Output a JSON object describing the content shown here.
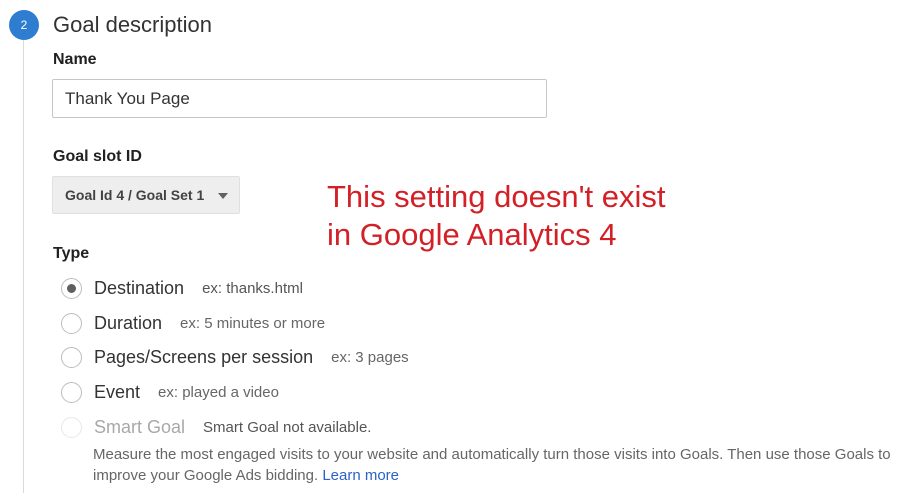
{
  "step": {
    "number": "2",
    "title": "Goal description"
  },
  "name_field": {
    "label": "Name",
    "value": "Thank You Page"
  },
  "goal_slot": {
    "label": "Goal slot ID",
    "selected": "Goal Id 4 / Goal Set 1"
  },
  "annotation": {
    "line1": "This setting doesn't exist",
    "line2": "in Google Analytics 4"
  },
  "type": {
    "label": "Type",
    "options": [
      {
        "label": "Destination",
        "hint": "ex: thanks.html",
        "selected": true
      },
      {
        "label": "Duration",
        "hint": "ex: 5 minutes or more",
        "selected": false
      },
      {
        "label": "Pages/Screens per session",
        "hint": "ex: 3 pages",
        "selected": false
      },
      {
        "label": "Event",
        "hint": "ex: played a video",
        "selected": false
      },
      {
        "label": "Smart Goal",
        "hint": "Smart Goal not available.",
        "selected": false,
        "disabled": true
      }
    ],
    "smart_description": "Measure the most engaged visits to your website and automatically turn those visits into Goals. Then use those Goals to improve your Google Ads bidding.",
    "learn_more": "Learn more"
  },
  "colors": {
    "accent": "#2e7dd1",
    "annotation": "#d32027",
    "link": "#2a62c8"
  }
}
